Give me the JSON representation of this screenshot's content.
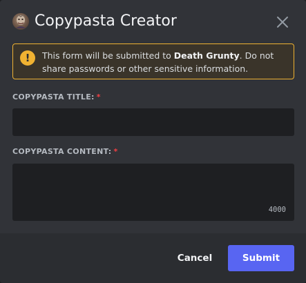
{
  "modal": {
    "title": "Copypasta Creator",
    "close_icon": "close-icon"
  },
  "warning": {
    "icon": "exclamation-icon",
    "text_before": "This form will be submitted to ",
    "bot_name": "Death Grunty",
    "text_after": ". Do not share passwords or other sensitive information."
  },
  "fields": {
    "title": {
      "label": "COPYPASTA TITLE:",
      "required_mark": "*",
      "value": "",
      "placeholder": ""
    },
    "content": {
      "label": "COPYPASTA CONTENT:",
      "required_mark": "*",
      "value": "",
      "placeholder": "",
      "char_limit": "4000"
    }
  },
  "footer": {
    "cancel_label": "Cancel",
    "submit_label": "Submit"
  },
  "colors": {
    "background": "#313338",
    "footer": "#2b2d31",
    "input": "#1e1f22",
    "warning_border": "#f0b232",
    "required": "#f23f43",
    "brand": "#5865f2"
  }
}
